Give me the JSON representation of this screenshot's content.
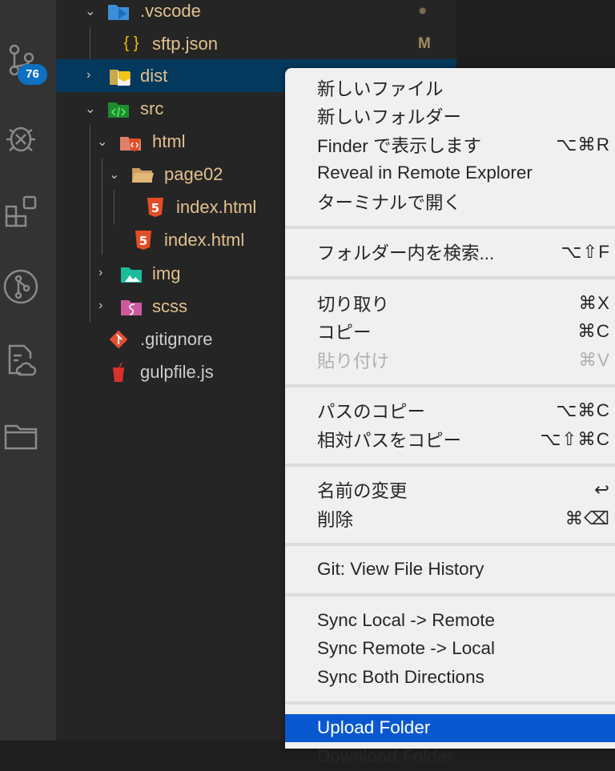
{
  "activity_bar": {
    "scm_badge": "76"
  },
  "explorer": {
    "items": [
      {
        "name": ".vscode",
        "decoration": "●"
      },
      {
        "name": "sftp.json",
        "decoration": "M"
      },
      {
        "name": "dist"
      },
      {
        "name": "src"
      },
      {
        "name": "html"
      },
      {
        "name": "page02"
      },
      {
        "name": "index.html"
      },
      {
        "name": "index.html"
      },
      {
        "name": "img"
      },
      {
        "name": "scss"
      },
      {
        "name": ".gitignore"
      },
      {
        "name": "gulpfile.js"
      }
    ]
  },
  "context_menu": {
    "groups": [
      [
        {
          "label": "新しいファイル",
          "shortcut": ""
        },
        {
          "label": "新しいフォルダー",
          "shortcut": ""
        },
        {
          "label": "Finder で表示します",
          "shortcut": "⌥⌘R"
        },
        {
          "label": "Reveal in Remote Explorer",
          "shortcut": ""
        },
        {
          "label": "ターミナルで開く",
          "shortcut": ""
        }
      ],
      [
        {
          "label": "フォルダー内を検索...",
          "shortcut": "⌥⇧F"
        }
      ],
      [
        {
          "label": "切り取り",
          "shortcut": "⌘X"
        },
        {
          "label": "コピー",
          "shortcut": "⌘C"
        },
        {
          "label": "貼り付け",
          "shortcut": "⌘V"
        }
      ],
      [
        {
          "label": "パスのコピー",
          "shortcut": "⌥⌘C"
        },
        {
          "label": "相対パスをコピー",
          "shortcut": "⌥⇧⌘C"
        }
      ],
      [
        {
          "label": "名前の変更",
          "shortcut": "↩"
        },
        {
          "label": "削除",
          "shortcut": "⌘⌫"
        }
      ],
      [
        {
          "label": "Git: View File History",
          "shortcut": ""
        }
      ],
      [
        {
          "label": "Sync Local -> Remote",
          "shortcut": ""
        },
        {
          "label": "Sync Remote -> Local",
          "shortcut": ""
        },
        {
          "label": "Sync Both Directions",
          "shortcut": ""
        }
      ],
      [
        {
          "label": "Upload Folder",
          "shortcut": ""
        },
        {
          "label": "Download Folder",
          "shortcut": ""
        }
      ]
    ]
  }
}
